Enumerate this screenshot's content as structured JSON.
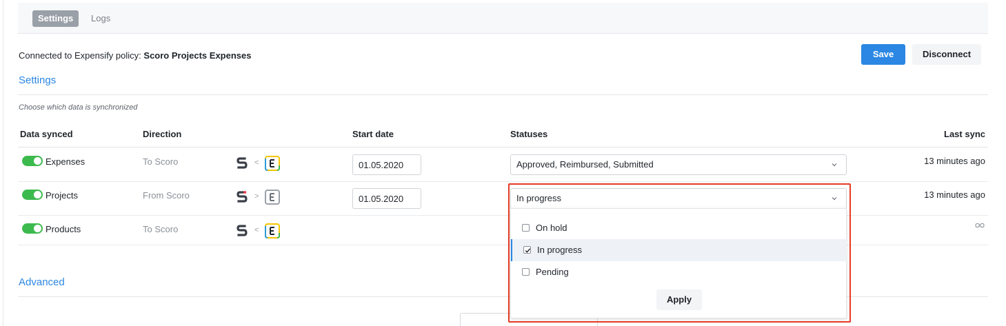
{
  "tabs": [
    {
      "label": "Settings",
      "active": true
    },
    {
      "label": "Logs",
      "active": false
    }
  ],
  "policy": {
    "prefix": "Connected to Expensify policy:",
    "name": "Scoro Projects Expenses"
  },
  "actions": {
    "save_label": "Save",
    "disconnect_label": "Disconnect"
  },
  "settings": {
    "title": "Settings",
    "hint": "Choose which data is synchronized",
    "columns": {
      "data_synced": "Data synced",
      "direction": "Direction",
      "start_date": "Start date",
      "statuses": "Statuses",
      "last_sync": "Last sync"
    },
    "rows": [
      {
        "name": "Expenses",
        "enabled": true,
        "direction": "To Scoro",
        "arrow": "<",
        "start_date": "01.05.2020",
        "statuses": "Approved, Reimbursed, Submitted",
        "last_sync": "13 minutes ago"
      },
      {
        "name": "Projects",
        "enabled": true,
        "direction": "From Scoro",
        "arrow": ">",
        "start_date": "01.05.2020",
        "statuses": "In progress",
        "last_sync": "13 minutes ago"
      },
      {
        "name": "Products",
        "enabled": true,
        "direction": "To Scoro",
        "arrow": "<",
        "last_sync_icon": "infinity-icon"
      }
    ]
  },
  "status_dropdown": {
    "options": [
      {
        "label": "On hold",
        "checked": false
      },
      {
        "label": "In progress",
        "checked": true
      },
      {
        "label": "Pending",
        "checked": false
      }
    ],
    "apply_label": "Apply"
  },
  "advanced": {
    "title": "Advanced"
  },
  "colors": {
    "accent": "#2b87e3",
    "toggle_on": "#3dba4e",
    "highlight": "#e53a26"
  }
}
